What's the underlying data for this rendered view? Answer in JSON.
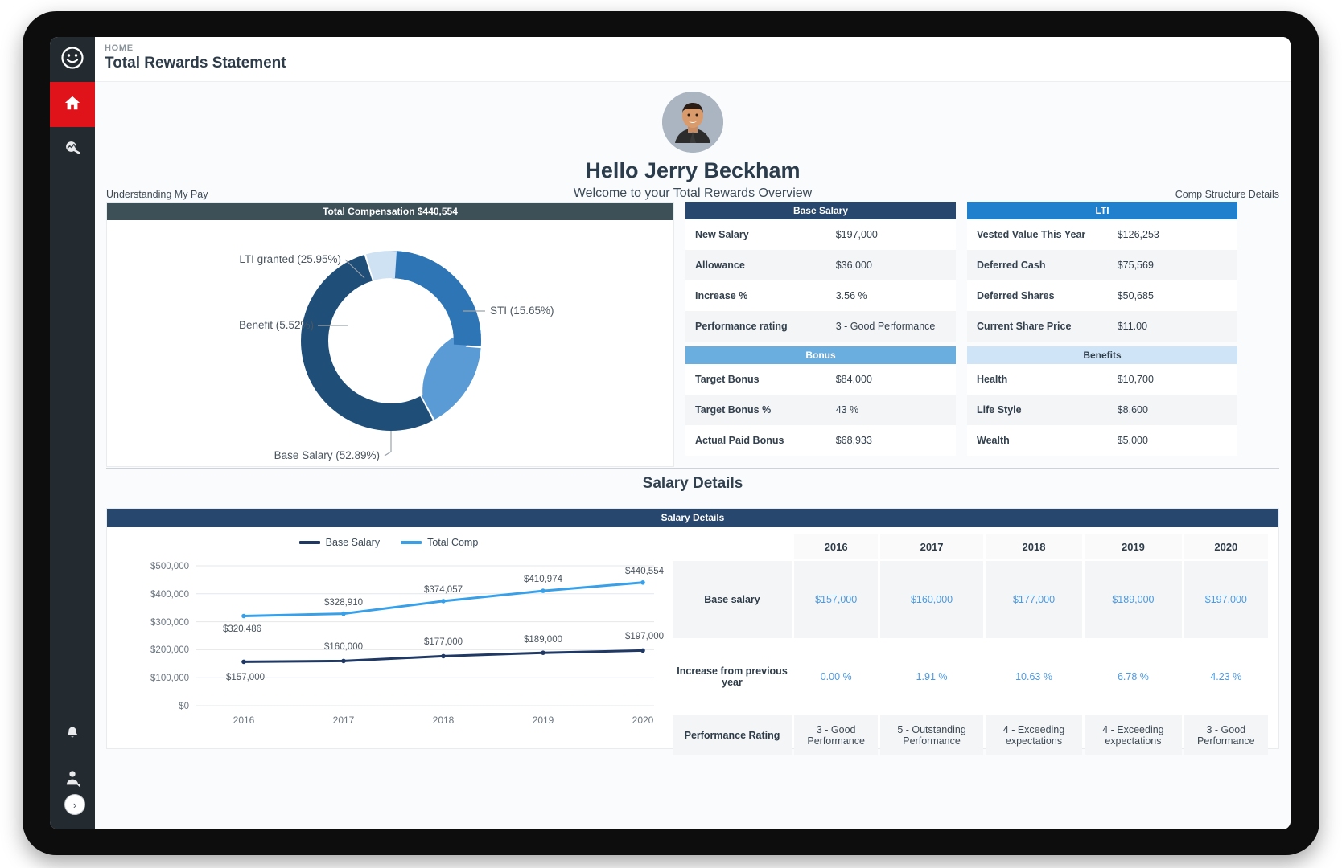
{
  "breadcrumb": "HOME",
  "page_title": "Total Rewards Statement",
  "sidebar": {
    "items": [
      {
        "name": "smiley-logo",
        "icon": "smiley-icon",
        "active": false
      },
      {
        "name": "home",
        "icon": "home-icon",
        "active": true
      },
      {
        "name": "people-analytics",
        "icon": "people-search-icon",
        "active": false
      }
    ],
    "bottom_items": [
      {
        "name": "notifications",
        "icon": "bell-icon"
      },
      {
        "name": "profile",
        "icon": "person-icon"
      }
    ],
    "expand_label": "›"
  },
  "hero": {
    "greeting": "Hello Jerry Beckham",
    "subtitle": "Welcome to your Total Rewards Overview",
    "avatar_alt": "avatar"
  },
  "links": {
    "left": "Understanding My Pay",
    "right": "Comp Structure Details"
  },
  "donut_panel": {
    "header": "Total Compensation  $440,554"
  },
  "base_salary": {
    "header": "Base Salary",
    "rows": [
      {
        "label": "New Salary",
        "value": "$197,000"
      },
      {
        "label": "Allowance",
        "value": "$36,000"
      },
      {
        "label": "Increase %",
        "value": "3.56 %"
      },
      {
        "label": "Performance rating",
        "value": "3 - Good Performance"
      }
    ]
  },
  "bonus": {
    "header": "Bonus",
    "rows": [
      {
        "label": "Target Bonus",
        "value": "$84,000"
      },
      {
        "label": "Target Bonus %",
        "value": "43 %"
      },
      {
        "label": "Actual Paid Bonus",
        "value": "$68,933"
      }
    ]
  },
  "lti": {
    "header": "LTI",
    "rows": [
      {
        "label": "Vested Value This Year",
        "value": "$126,253"
      },
      {
        "label": "Deferred Cash",
        "value": "$75,569"
      },
      {
        "label": "Deferred Shares",
        "value": "$50,685"
      },
      {
        "label": "Current  Share Price",
        "value": "$11.00"
      }
    ]
  },
  "benefits": {
    "header": "Benefits",
    "rows": [
      {
        "label": "Health",
        "value": "$10,700"
      },
      {
        "label": "Life Style",
        "value": "$8,600"
      },
      {
        "label": "Wealth",
        "value": "$5,000"
      }
    ]
  },
  "salary_details": {
    "section_title": "Salary Details",
    "panel_header": "Salary Details",
    "columns": [
      "2016",
      "2017",
      "2018",
      "2019",
      "2020"
    ],
    "rows": [
      {
        "label": "Base salary",
        "values": [
          "$157,000",
          "$160,000",
          "$177,000",
          "$189,000",
          "$197,000"
        ],
        "style": "blue"
      },
      {
        "label": "Increase from previous year",
        "values": [
          "0.00 %",
          "1.91 %",
          "10.63 %",
          "6.78 %",
          "4.23 %"
        ],
        "style": "blue"
      },
      {
        "label": "Performance Rating",
        "values": [
          "3 - Good Performance",
          "5 - Outstanding Performance",
          "4 - Exceeding expectations",
          "4 - Exceeding expectations",
          "3 - Good Performance"
        ],
        "style": "dark"
      }
    ]
  },
  "colors": {
    "accent_red": "#e0121a",
    "sidebar": "#242b30",
    "header_dark": "#3d4f57",
    "navy": "#27476e",
    "blue": "#2180ce",
    "mid_blue": "#6aaee0",
    "light_blue": "#cfe5f7",
    "donut_base_salary": "#1f4e79",
    "donut_sti": "#5b9bd5",
    "donut_lti": "#2e75b6",
    "donut_benefit": "#cfe2f3"
  },
  "chart_data": [
    {
      "type": "pie",
      "title": "Total Compensation  $440,554",
      "total": 440554,
      "labels": [
        "Base Salary",
        "STI",
        "LTI granted",
        "Benefit"
      ],
      "annotations": [
        "Base Salary  (52.89%)",
        "STI  (15.65%)",
        "LTI granted  (25.95%)",
        "Benefit  (5.52%)"
      ],
      "values": [
        52.89,
        15.65,
        25.95,
        5.52
      ],
      "colors": [
        "#1f4e79",
        "#5b9bd5",
        "#2e75b6",
        "#cfe2f3"
      ],
      "donut": true,
      "legend": "none"
    },
    {
      "type": "line",
      "title": "Salary Details",
      "x": [
        "2016",
        "2017",
        "2018",
        "2019",
        "2020"
      ],
      "series": [
        {
          "name": "Base Salary",
          "color": "#1f3864",
          "values": [
            157000,
            160000,
            177000,
            189000,
            197000
          ],
          "labels": [
            "$157,000",
            "$160,000",
            "$177,000",
            "$189,000",
            "$197,000"
          ]
        },
        {
          "name": "Total Comp",
          "color": "#38a0e8",
          "values": [
            320486,
            328910,
            374057,
            410974,
            440554
          ],
          "labels": [
            "$320,486",
            "$328,910",
            "$374,057",
            "$410,974",
            "$440,554"
          ]
        }
      ],
      "ylim": [
        0,
        500000
      ],
      "yticks": [
        "$0",
        "$100,000",
        "$200,000",
        "$300,000",
        "$400,000",
        "$500,000"
      ],
      "xlabel": "",
      "ylabel": "",
      "grid": true,
      "legend": "top"
    }
  ]
}
